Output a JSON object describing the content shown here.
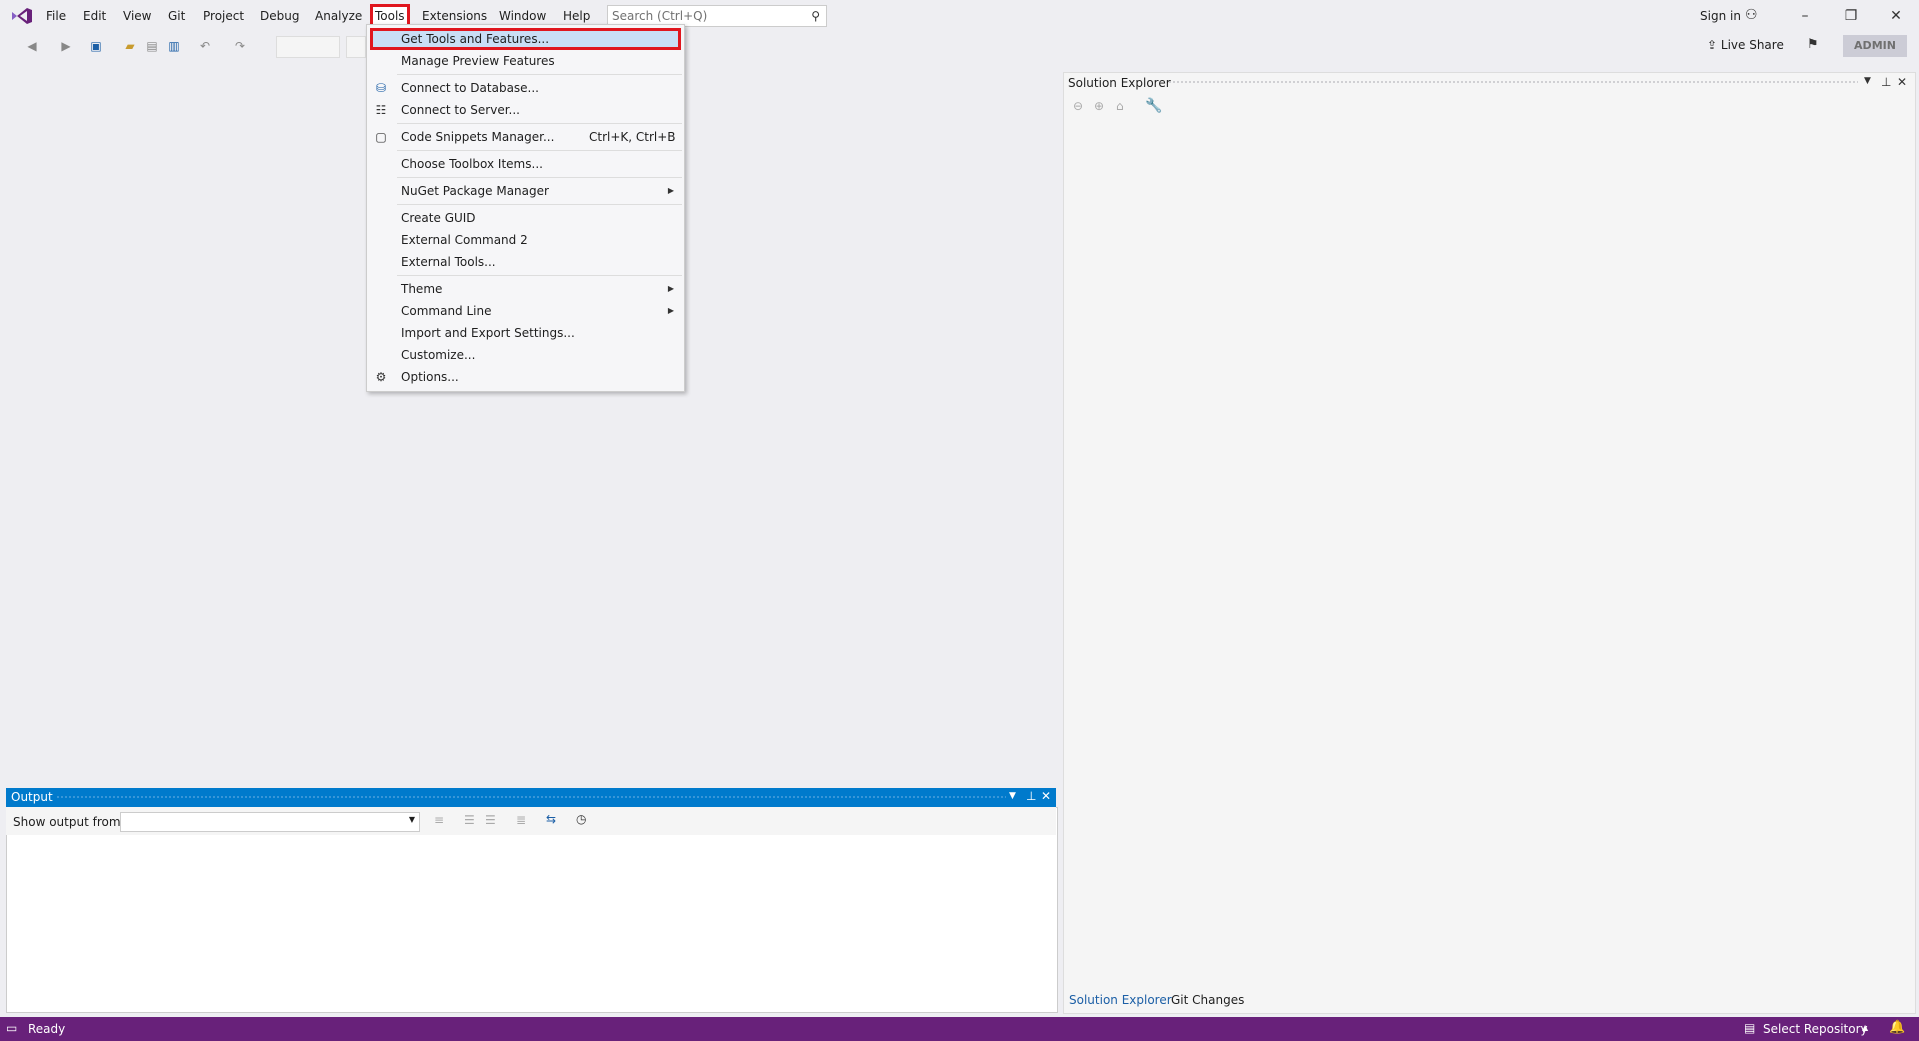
{
  "menubar": {
    "items": [
      "File",
      "Edit",
      "View",
      "Git",
      "Project",
      "Debug",
      "Analyze",
      "Tools",
      "Extensions",
      "Window",
      "Help"
    ],
    "search_placeholder": "Search (Ctrl+Q)",
    "sign_in": "Sign in"
  },
  "toolbar": {
    "live_share": "Live Share",
    "admin": "ADMIN"
  },
  "tools_menu": {
    "items": [
      {
        "label": "Get Tools and Features...",
        "highlighted": true
      },
      {
        "label": "Manage Preview Features"
      },
      {
        "label": "Connect to Database...",
        "icon": "database-icon"
      },
      {
        "label": "Connect to Server...",
        "icon": "server-icon"
      },
      {
        "label": "Code Snippets Manager...",
        "shortcut": "Ctrl+K, Ctrl+B",
        "icon": "snippets-icon"
      },
      {
        "label": "Choose Toolbox Items..."
      },
      {
        "label": "NuGet Package Manager",
        "submenu": true
      },
      {
        "label": "Create GUID"
      },
      {
        "label": "External Command 2"
      },
      {
        "label": "External Tools..."
      },
      {
        "label": "Theme",
        "submenu": true
      },
      {
        "label": "Command Line",
        "submenu": true
      },
      {
        "label": "Import and Export Settings..."
      },
      {
        "label": "Customize..."
      },
      {
        "label": "Options...",
        "icon": "gear-icon"
      }
    ]
  },
  "solution_explorer": {
    "title": "Solution Explorer",
    "tabs": [
      "Solution Explorer",
      "Git Changes"
    ]
  },
  "output": {
    "title": "Output",
    "show_output_from": "Show output from:"
  },
  "status": {
    "ready": "Ready",
    "select_repository": "Select Repository"
  },
  "colors": {
    "accent": "#007acc",
    "status_bar": "#68217a",
    "highlight_outline": "#e0161e"
  }
}
